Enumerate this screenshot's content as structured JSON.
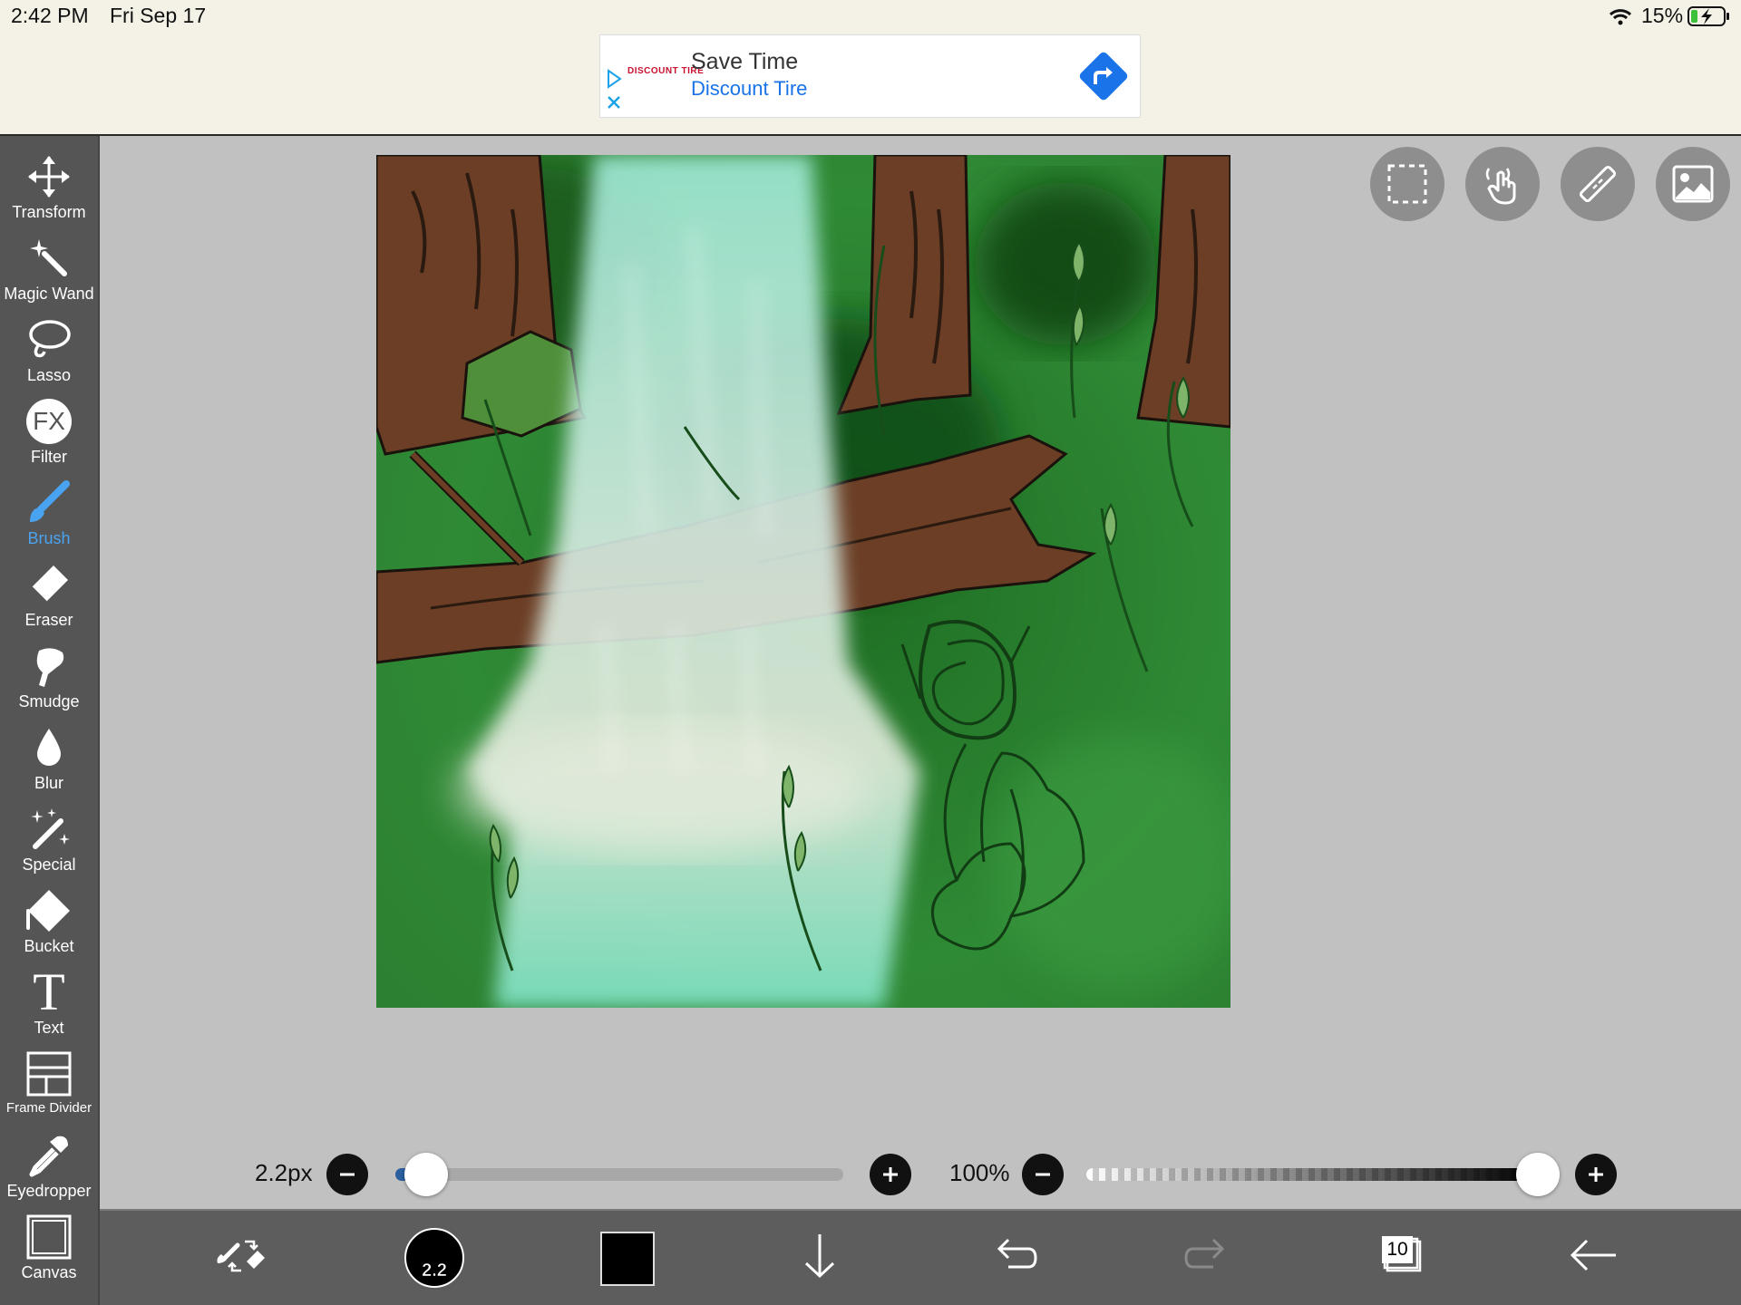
{
  "status": {
    "time": "2:42 PM",
    "date": "Fri Sep 17",
    "battery": "15%"
  },
  "ad": {
    "title": "Save Time",
    "subtitle": "Discount Tire",
    "logo": "DISCOUNT TIRE"
  },
  "tools": [
    {
      "label": "Transform",
      "icon": "move-arrows-icon"
    },
    {
      "label": "Magic Wand",
      "icon": "magic-wand-icon"
    },
    {
      "label": "Lasso",
      "icon": "lasso-icon"
    },
    {
      "label": "Filter",
      "icon": "fx-icon",
      "glyph": "FX"
    },
    {
      "label": "Brush",
      "icon": "brush-icon",
      "active": true
    },
    {
      "label": "Eraser",
      "icon": "eraser-icon"
    },
    {
      "label": "Smudge",
      "icon": "smudge-icon"
    },
    {
      "label": "Blur",
      "icon": "blur-drop-icon"
    },
    {
      "label": "Special",
      "icon": "special-sparkle-icon"
    },
    {
      "label": "Bucket",
      "icon": "bucket-icon"
    },
    {
      "label": "Text",
      "icon": "text-icon",
      "glyph": "T"
    },
    {
      "label": "Frame Divider",
      "icon": "frame-divider-icon"
    },
    {
      "label": "Eyedropper",
      "icon": "eyedropper-icon"
    },
    {
      "label": "Canvas",
      "icon": "canvas-icon"
    }
  ],
  "top_tools": [
    "selection-icon",
    "gesture-hand-icon",
    "ruler-icon",
    "reference-image-icon"
  ],
  "brush": {
    "size_label": "2.2px",
    "size_fraction": 0.04,
    "size_badge": "2.2"
  },
  "opacity": {
    "label": "100%",
    "fraction": 1.0
  },
  "layers": {
    "count": "10"
  },
  "colors": {
    "accent": "#4aa3f0",
    "toolbar": "#555555",
    "bottombar": "#5d5d5d",
    "current_color": "#000000"
  }
}
